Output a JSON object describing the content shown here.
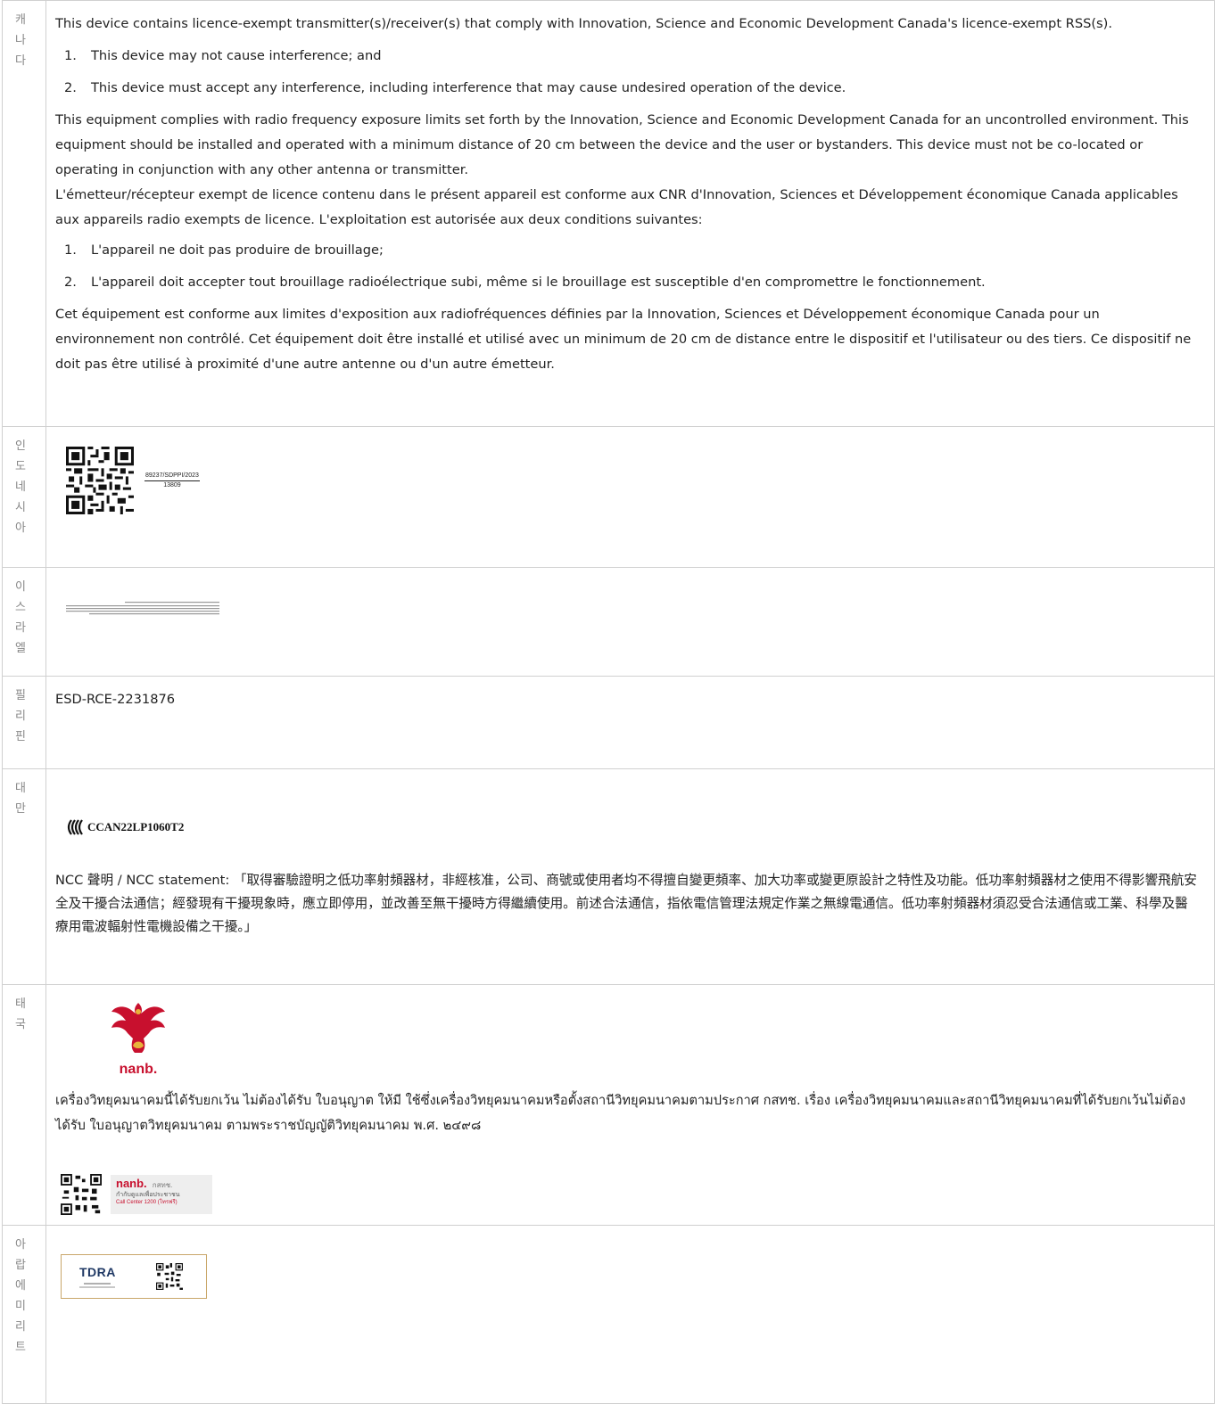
{
  "rows": [
    {
      "country": [
        "캐",
        "나",
        "다"
      ],
      "para1": "This device contains licence-exempt transmitter(s)/receiver(s) that comply with Innovation, Science and Economic Development Canada's licence-exempt RSS(s).",
      "list1": [
        "This device may not cause interference; and",
        "This device must accept any interference, including interference that may cause undesired operation of the device."
      ],
      "para2": "This equipment complies with radio frequency exposure limits set forth by the Innovation, Science and Economic Development Canada for an uncontrolled environment. This equipment should be installed and operated with a minimum distance of 20 cm between the device and the user or bystanders. This device must not be co-located or operating in conjunction with any other antenna or transmitter.",
      "para3": "L'émetteur/récepteur exempt de licence contenu dans le présent appareil est conforme aux CNR d'Innovation, Sciences et Développement économique Canada applicables aux appareils radio exempts de licence. L'exploitation est autorisée aux deux conditions suivantes:",
      "list2": [
        "L'appareil ne doit pas produire de brouillage;",
        "L'appareil doit accepter tout brouillage radioélectrique subi, même si le brouillage est susceptible d'en compromettre le fonctionnement."
      ],
      "para4": "Cet équipement est conforme aux limites d'exposition aux radiofréquences définies par la Innovation, Sciences et Développement économique Canada pour un environnement non contrôlé. Cet équipement doit être installé et utilisé avec un minimum de 20 cm de distance entre le dispositif et l'utilisateur ou des tiers. Ce dispositif ne doit pas être utilisé à proximité d'une autre antenne ou d'un autre émetteur."
    },
    {
      "country": [
        "인",
        "도",
        "네",
        "시",
        "아"
      ],
      "cert_top": "89237/SDPPI/2023",
      "cert_bottom": "13809"
    },
    {
      "country": [
        "이",
        "스",
        "라",
        "엘"
      ]
    },
    {
      "country": [
        "필",
        "리",
        "핀"
      ],
      "text": "ESD-RCE-2231876"
    },
    {
      "country": [
        "대",
        "만"
      ],
      "ncc_id": "CCAN22LP1060T2",
      "statement": "NCC 聲明 / NCC statement: 「取得審驗證明之低功率射頻器材，非經核准，公司、商號或使用者均不得擅自變更頻率、加大功率或變更原設計之特性及功能。低功率射頻器材之使用不得影響飛航安全及干擾合法通信；經發現有干擾現象時，應立即停用，並改善至無干擾時方得繼續使用。前述合法通信，指依電信管理法規定作業之無線電通信。低功率射頻器材須忍受合法通信或工業、科學及醫療用電波輻射性電機設備之干擾。」"
    },
    {
      "country": [
        "태",
        "국"
      ],
      "logo_text": "nanb.",
      "thai_text": "เครื่องวิทยุคมนาคมนี้ได้รับยกเว้น ไม่ต้องได้รับ ใบอนุญาต ให้มี ใช้ซึ่งเครื่องวิทยุคมนาคมหรือตั้งสถานีวิทยุคมนาคมตามประกาศ กสทช. เรื่อง เครื่องวิทยุคมนาคมและสถานีวิทยุคมนาคมที่ได้รับยกเว้นไม่ต้องได้รับ ใบอนุญาตวิทยุคมนาคม ตามพระราชบัญญัติวิทยุคมนาคม พ.ศ. ๒๔๙๘",
      "badge_brand": "nanb.",
      "badge_thai": "กสทช.",
      "badge_line1": "กำกับดูแลเพื่อประชาชน",
      "badge_line2": "Call Center 1200 (โทรฟรี)"
    },
    {
      "country": [
        "아",
        "랍",
        "에",
        "미",
        "리",
        "트"
      ],
      "tdra": "TDRA"
    }
  ],
  "colors": {
    "border": "#d0d0d0",
    "country_text": "#888888",
    "body_text": "#222222",
    "thai_red": "#c8102e",
    "tdra_border": "#c9a76a"
  },
  "icons": [
    "qr-code-icon",
    "ncc-wave-icon",
    "garuda-emblem-icon"
  ]
}
